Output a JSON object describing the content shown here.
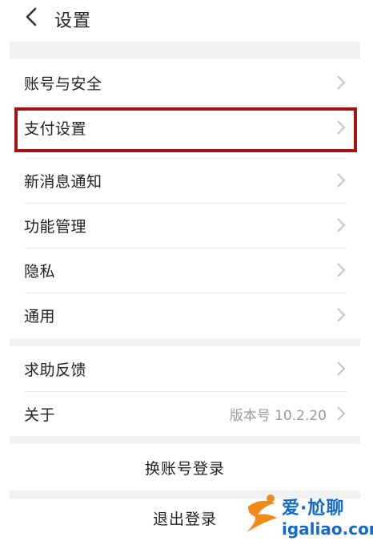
{
  "header": {
    "title": "设置"
  },
  "group1": [
    {
      "label": "账号与安全"
    },
    {
      "label": "支付设置"
    },
    {
      "label": "新消息通知"
    },
    {
      "label": "功能管理"
    },
    {
      "label": "隐私"
    },
    {
      "label": "通用"
    }
  ],
  "group2": [
    {
      "label": "求助反馈"
    },
    {
      "label": "关于",
      "value": "版本号 10.2.20"
    }
  ],
  "actions": {
    "switch_account": "换账号登录",
    "logout": "退出登录"
  },
  "watermark": {
    "brand": "爱·尬聊",
    "site": "igaliao.com"
  },
  "colors": {
    "highlight_border": "#a31515",
    "separator": "#f1f1f1",
    "watermark": "#1569c7"
  }
}
